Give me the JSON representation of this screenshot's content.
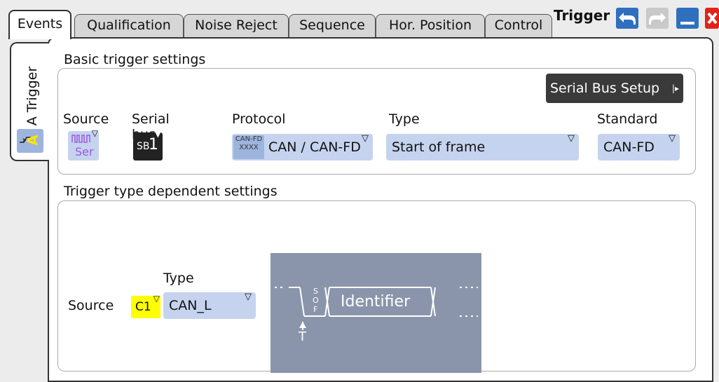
{
  "tabs": [
    {
      "label": "Events",
      "active": true
    },
    {
      "label": "Qualification"
    },
    {
      "label": "Noise Reject"
    },
    {
      "label": "Sequence"
    },
    {
      "label": "Hor. Position"
    },
    {
      "label": "Control"
    }
  ],
  "window": {
    "title": "Trigger",
    "buttons": [
      "undo-icon",
      "redo-icon",
      "minimize-icon",
      "close-icon"
    ]
  },
  "side_tab": {
    "label": "A Trigger",
    "badge": "A"
  },
  "basic": {
    "title": "Basic trigger settings",
    "serial_bus_setup": "Serial Bus Setup",
    "source": {
      "label": "Source",
      "icon_text": "Ser"
    },
    "serial_bus": {
      "label": "Serial bus",
      "prefix": "SB",
      "value": "1"
    },
    "protocol": {
      "label": "Protocol",
      "icon_text": "CAN-FD",
      "value": "CAN / CAN-FD"
    },
    "type": {
      "label": "Type",
      "value": "Start of frame"
    },
    "standard": {
      "label": "Standard",
      "value": "CAN-FD"
    }
  },
  "dependent": {
    "title": "Trigger type dependent settings",
    "source_label": "Source",
    "channel": "C1",
    "type_label": "Type",
    "type_value": "CAN_L",
    "diagram": {
      "sof_letters": [
        "S",
        "O",
        "F"
      ],
      "field": "Identifier",
      "marker": "T"
    }
  },
  "colors": {
    "dropdown": "#c5d3ee",
    "channel": "#ffff00",
    "diagram_bg": "#8a95ab",
    "close": "#e2231a",
    "nav_button": "#2f6fbd"
  }
}
